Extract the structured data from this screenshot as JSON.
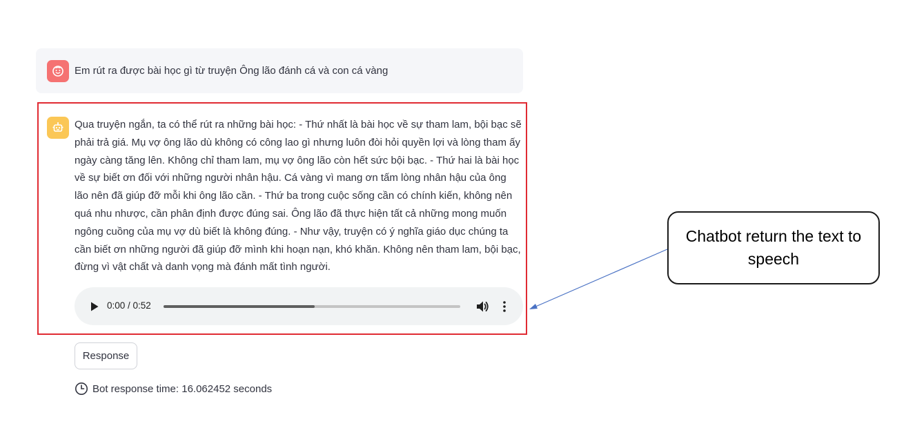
{
  "user_message": {
    "text": "Em rút ra được bài học gì từ truyện Ông lão đánh cá và con cá vàng",
    "avatar_icon": "face-icon",
    "avatar_color": "#f57272"
  },
  "bot_message": {
    "text": "Qua truyện ngắn, ta có thể rút ra những bài học: - Thứ nhất là bài học về sự tham lam, bội bạc sẽ phải trả giá. Mụ vợ ông lão dù không có công lao gì nhưng luôn đòi hỏi quyền lợi và lòng tham ấy ngày càng tăng lên. Không chỉ tham lam, mụ vợ ông lão còn hết sức bội bạc. - Thứ hai là bài học về sự biết ơn đối với những người nhân hậu. Cá vàng vì mang ơn tấm lòng nhân hậu của ông lão nên đã giúp đỡ mỗi khi ông lão cần. - Thứ ba trong cuộc sống cần có chính kiến, không nên quá nhu nhược, cần phân định được đúng sai. Ông lão đã thực hiện tất cả những mong muốn ngông cuồng của mụ vợ dù biết là không đúng. - Như vậy, truyện có ý nghĩa giáo dục chúng ta cần biết ơn những người đã giúp đỡ mình khi hoạn nạn, khó khăn. Không nên tham lam, bội bạc, đừng vì vật chất và danh vọng mà đánh mất tình người.",
    "avatar_icon": "robot-icon",
    "avatar_color": "#fbc756",
    "highlight_color": "#e02a32"
  },
  "audio_player": {
    "time_display": "0:00 / 0:52",
    "progress_fraction": 0.51
  },
  "response_button": {
    "label": "Response"
  },
  "response_time": {
    "text": "Bot response time: 16.062452 seconds"
  },
  "callout": {
    "text": "Chatbot return the text to speech",
    "arrow_color": "#4a72c4"
  }
}
